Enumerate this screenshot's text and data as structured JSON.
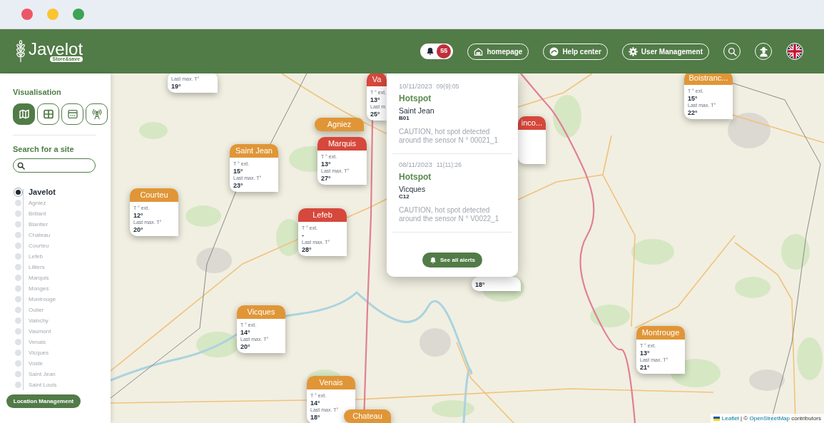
{
  "window": {
    "controls": [
      {
        "color": "#ec5766"
      },
      {
        "color": "#fbc431"
      },
      {
        "color": "#3da454"
      }
    ]
  },
  "header": {
    "logo": {
      "title": "Javelot",
      "tagline": "Store&save"
    },
    "notifications": {
      "count": "55"
    },
    "nav": [
      {
        "kind": "home",
        "label": "homepage"
      },
      {
        "kind": "help",
        "label": "Help center"
      },
      {
        "kind": "users",
        "label": "User Management"
      }
    ],
    "icon_buttons": [
      {
        "kind": "search"
      },
      {
        "kind": "profile"
      },
      {
        "kind": "language"
      }
    ]
  },
  "sidebar": {
    "visualisation": {
      "title": "Visualisation",
      "views": [
        {
          "kind": "map",
          "selected": true
        },
        {
          "kind": "table",
          "selected": false
        },
        {
          "kind": "panel",
          "selected": false
        },
        {
          "kind": "antenna",
          "selected": false
        }
      ]
    },
    "search": {
      "label": "Search for a site"
    },
    "sites": [
      {
        "label": "Javelot",
        "selected": true
      },
      {
        "label": "Agniez",
        "selected": false
      },
      {
        "label": "Brillant",
        "selected": false
      },
      {
        "label": "Blantier",
        "selected": false
      },
      {
        "label": "Chateau",
        "selected": false
      },
      {
        "label": "Courteu",
        "selected": false
      },
      {
        "label": "Lefeb",
        "selected": false
      },
      {
        "label": "Lilliers",
        "selected": false
      },
      {
        "label": "Marquis",
        "selected": false
      },
      {
        "label": "Monges",
        "selected": false
      },
      {
        "label": "Montrouge",
        "selected": false
      },
      {
        "label": "Oulier",
        "selected": false
      },
      {
        "label": "Vainchy",
        "selected": false
      },
      {
        "label": "Vaumont",
        "selected": false
      },
      {
        "label": "Venais",
        "selected": false
      },
      {
        "label": "Vicques",
        "selected": false
      },
      {
        "label": "Voste",
        "selected": false
      },
      {
        "label": "Saint Jean",
        "selected": false
      },
      {
        "label": "Saint Louis",
        "selected": false
      }
    ],
    "button": "Location Management"
  },
  "map": {
    "markers": [
      {
        "max_label": "Last max. T°",
        "max": "19°"
      },
      {
        "name": "Va",
        "color": "#d6483c",
        "temp_label": "T ° ext.",
        "temp": "13°",
        "max_label": "Last m",
        "max": "25°"
      },
      {
        "name": "Boistranc...",
        "color": "#e09637",
        "temp_label": "T ° ext.",
        "temp": "15°",
        "max_label": "Last max. T°",
        "max": "22°"
      },
      {
        "name": "inco...",
        "color": "#d6483c"
      },
      {
        "name": "Agniez",
        "color": "#e09637"
      },
      {
        "name": "Marquis",
        "color": "#d6483c",
        "temp_label": "T ° ext.",
        "temp": "13°",
        "max_label": "Last max. T°",
        "max": "27°"
      },
      {
        "name": "Saint Jean",
        "color": "#e09637",
        "temp_label": "T ° ext.",
        "temp": "15°",
        "max_label": "Last max. T°",
        "max": "23°"
      },
      {
        "name": "Courteu",
        "color": "#e09637",
        "temp_label": "T ° ext.",
        "temp": "12°",
        "max_label": "Last max. T°",
        "max": "20°"
      },
      {
        "name": "Lefeb",
        "color": "#d6483c",
        "temp_label": "T ° ext.",
        "temp": "-",
        "max_label": "Last max. T°",
        "max": "28°"
      },
      {
        "max": "18°"
      },
      {
        "name": "Vicques",
        "color": "#e09637",
        "temp_label": "T ° ext.",
        "temp": "14°",
        "max_label": "Last max. T°",
        "max": "20°"
      },
      {
        "name": "Montrouge",
        "color": "#e09637",
        "temp_label": "T ° ext.",
        "temp": "13°",
        "max_label": "Last max. T°",
        "max": "21°"
      },
      {
        "name": "Venais",
        "color": "#e09637",
        "temp_label": "T ° ext.",
        "temp": "14°",
        "max_label": "Last max. T°",
        "max": "18°"
      },
      {
        "name": "Chateau",
        "color": "#e09637"
      }
    ],
    "attribution": [
      {
        "kind": "link",
        "text": "Leaflet"
      },
      {
        "kind": "text",
        "text": "| ©"
      },
      {
        "kind": "link",
        "text": "OpenStreetMap"
      },
      {
        "kind": "text",
        "text": "contributors"
      }
    ]
  },
  "alerts_panel": {
    "alerts": [
      {
        "date": "10/11/2023",
        "time": "09(9):05",
        "title": "Hotspot",
        "site": "Saint Jean",
        "code": "B01",
        "message": "CAUTION, hot spot detected around the sensor N ° 00021_1"
      },
      {
        "date": "08/11/2023",
        "time": "11(11):26",
        "title": "Hotspot",
        "site": "Vicques",
        "code": "C12",
        "message": "CAUTION, hot spot detected around the sensor N ° V0022_1"
      }
    ],
    "button": "See all alerts"
  }
}
